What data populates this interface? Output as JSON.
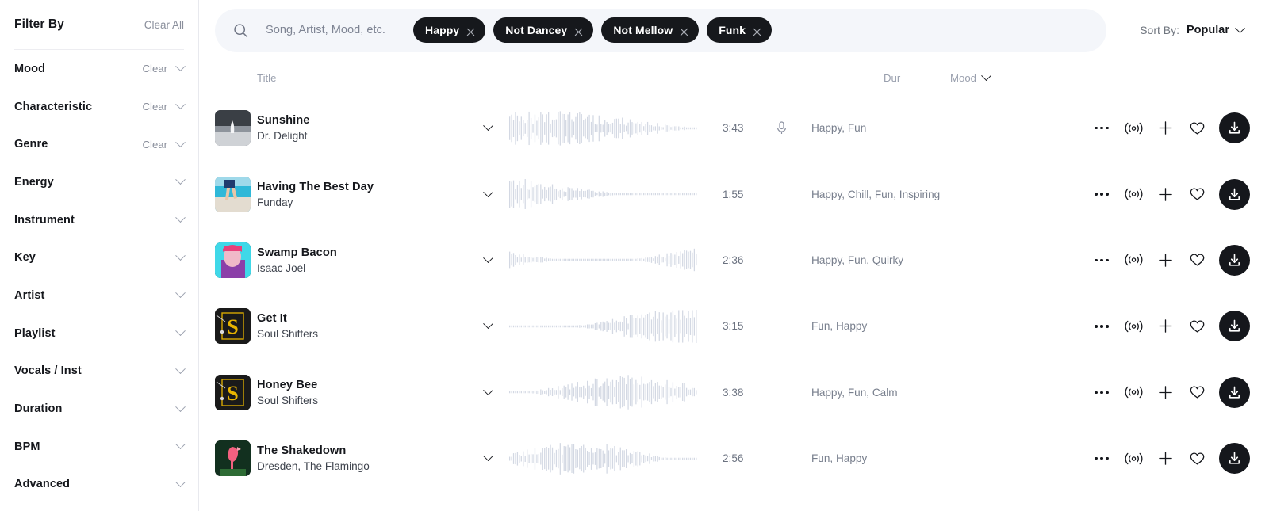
{
  "sidebar": {
    "title": "Filter By",
    "clear_all_label": "Clear All",
    "items": [
      {
        "label": "Mood",
        "clear_label": "Clear"
      },
      {
        "label": "Characteristic",
        "clear_label": "Clear"
      },
      {
        "label": "Genre",
        "clear_label": "Clear"
      },
      {
        "label": "Energy",
        "clear_label": ""
      },
      {
        "label": "Instrument",
        "clear_label": ""
      },
      {
        "label": "Key",
        "clear_label": ""
      },
      {
        "label": "Artist",
        "clear_label": ""
      },
      {
        "label": "Playlist",
        "clear_label": ""
      },
      {
        "label": "Vocals / Inst",
        "clear_label": ""
      },
      {
        "label": "Duration",
        "clear_label": ""
      },
      {
        "label": "BPM",
        "clear_label": ""
      },
      {
        "label": "Advanced",
        "clear_label": ""
      }
    ]
  },
  "search": {
    "placeholder": "Song, Artist, Mood, etc.",
    "value": "",
    "icon": "search-icon",
    "chips": [
      {
        "label": "Happy",
        "remove_icon": "close-icon"
      },
      {
        "label": "Not Dancey",
        "remove_icon": "close-icon"
      },
      {
        "label": "Not Mellow",
        "remove_icon": "close-icon"
      },
      {
        "label": "Funk",
        "remove_icon": "close-icon"
      }
    ]
  },
  "sort": {
    "label": "Sort By:",
    "value": "Popular",
    "icon": "chevron-down-icon"
  },
  "table": {
    "columns": {
      "title": "Title",
      "duration": "Dur",
      "mood": "Mood"
    },
    "rows": [
      {
        "title": "Sunshine",
        "artist": "Dr. Delight",
        "duration": "3:43",
        "mood": "Happy, Fun",
        "has_vocals": true,
        "art": "photo-silhouette-beach-bw"
      },
      {
        "title": "Having The Best Day",
        "artist": "Funday",
        "duration": "1:55",
        "mood": "Happy, Chill, Fun, Inspiring",
        "has_vocals": false,
        "art": "photo-legs-running-beach"
      },
      {
        "title": "Swamp Bacon",
        "artist": "Isaac Joel",
        "duration": "2:36",
        "mood": "Happy, Fun, Quirky",
        "has_vocals": false,
        "art": "photo-portrait-neon-glitch"
      },
      {
        "title": "Get It",
        "artist": "Soul Shifters",
        "duration": "3:15",
        "mood": "Fun, Happy",
        "has_vocals": false,
        "art": "logo-yellow-s-on-black"
      },
      {
        "title": "Honey Bee",
        "artist": "Soul Shifters",
        "duration": "3:38",
        "mood": "Happy, Fun, Calm",
        "has_vocals": false,
        "art": "logo-yellow-s-on-black"
      },
      {
        "title": "The Shakedown",
        "artist": "Dresden, The Flamingo",
        "duration": "2:56",
        "mood": "Fun, Happy",
        "has_vocals": false,
        "art": "photo-pink-flamingo-dark-green"
      }
    ],
    "row_actions": {
      "more": "more-options-icon",
      "similar": "find-similar-icon",
      "add": "add-to-playlist-icon",
      "favorite": "heart-icon",
      "download": "download-icon"
    }
  },
  "colors": {
    "chip_bg": "#16181c",
    "search_bg": "#f4f6fa",
    "waveform": "#d3d8e3",
    "muted_text": "#9aa0ae",
    "download_bg": "#15171c"
  }
}
